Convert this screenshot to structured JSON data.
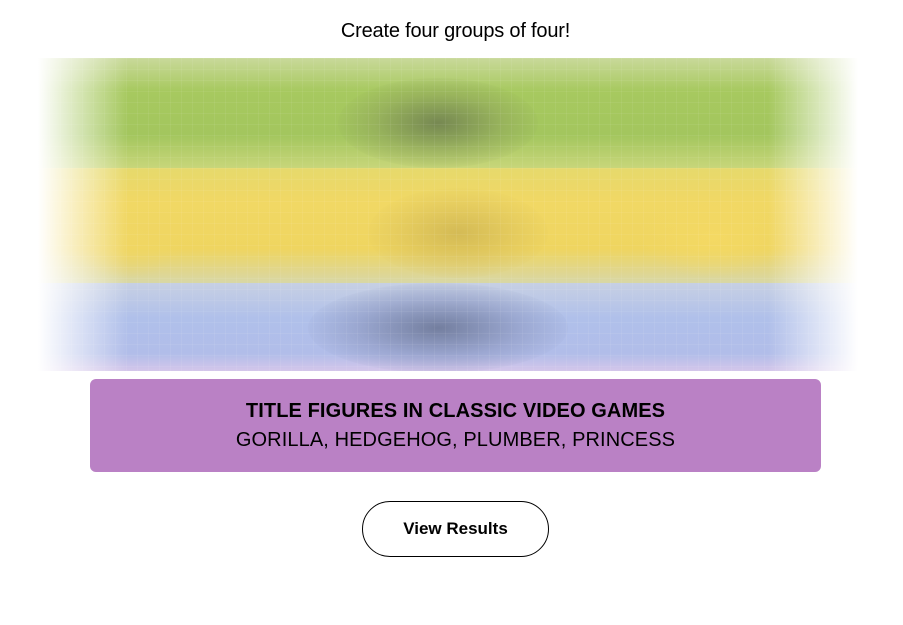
{
  "header": {
    "instructions": "Create four groups of four!"
  },
  "board": {
    "state": "blurred",
    "band_colors": [
      "#a7c95f",
      "#f1d864",
      "#b0c0ea"
    ]
  },
  "solved_group": {
    "title": "TITLE FIGURES IN CLASSIC VIDEO GAMES",
    "members": "GORILLA, HEDGEHOG, PLUMBER, PRINCESS",
    "color": "#ba81c5"
  },
  "actions": {
    "view_results_label": "View Results"
  }
}
